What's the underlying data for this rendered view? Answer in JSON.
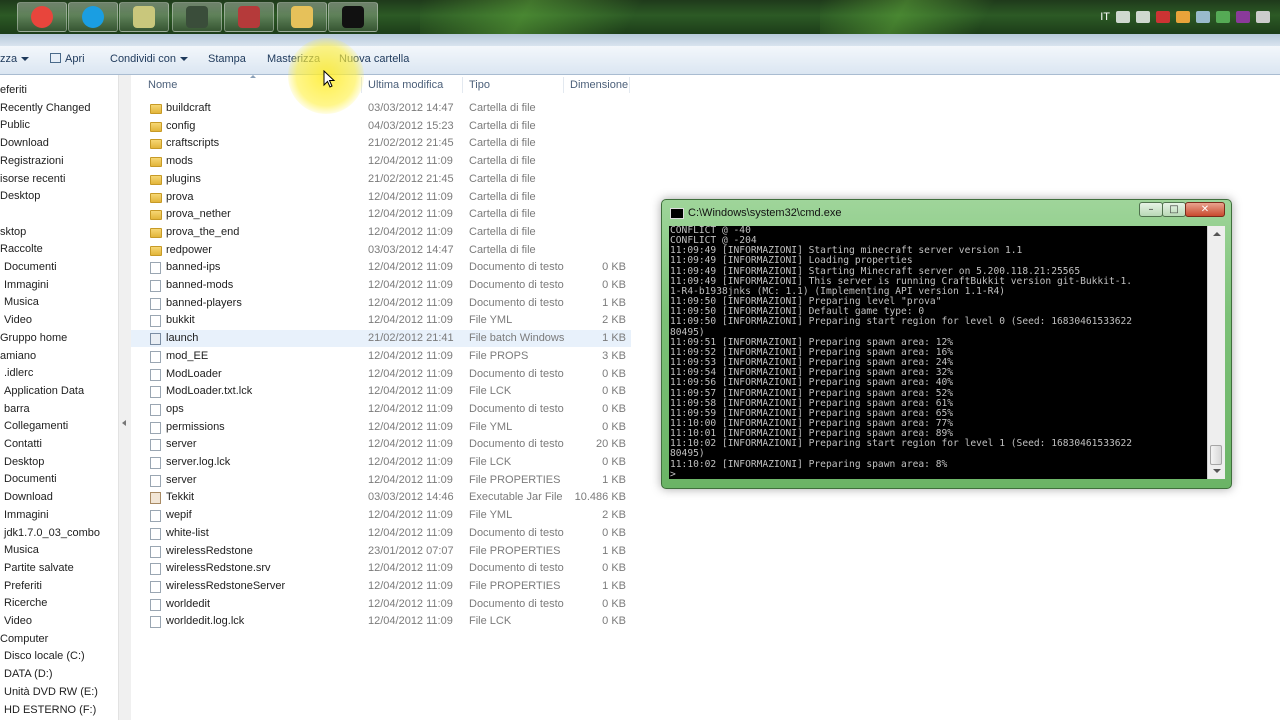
{
  "taskbar": {
    "apps": [
      {
        "name": "chrome",
        "color": "#e8453c"
      },
      {
        "name": "skype",
        "color": "#1a9ee2"
      },
      {
        "name": "notepad",
        "color": "#c9c77c"
      },
      {
        "name": "app4",
        "color": "#3a4d3a"
      },
      {
        "name": "app5",
        "color": "#b53a3a"
      },
      {
        "name": "explorer",
        "color": "#e6c15a"
      },
      {
        "name": "cmd",
        "color": "#111111"
      }
    ],
    "language": "IT"
  },
  "toolbar": {
    "organize": "zza",
    "open": "Apri",
    "share": "Condividi con",
    "print": "Stampa",
    "burn": "Masterizza",
    "new_folder": "Nuova cartella"
  },
  "nav": {
    "items": [
      "eferiti",
      "Recently Changed",
      "Public",
      "Download",
      "Registrazioni",
      "isorse recenti",
      "Desktop",
      "",
      "sktop",
      "Raccolte",
      "Documenti",
      "Immagini",
      "Musica",
      "Video",
      "Gruppo home",
      "amiano",
      ".idlerc",
      "Application Data",
      "barra",
      "Collegamenti",
      "Contatti",
      "Desktop",
      "Documenti",
      "Download",
      "Immagini",
      "jdk1.7.0_03_combo",
      "Musica",
      "Partite salvate",
      "Preferiti",
      "Ricerche",
      "Video",
      "Computer",
      "Disco locale (C:)",
      "DATA (D:)",
      "Unità DVD RW (E:)",
      "HD ESTERNO (F:)"
    ]
  },
  "columns": {
    "name": "Nome",
    "modified": "Ultima modifica",
    "type": "Tipo",
    "size": "Dimensione"
  },
  "files": [
    {
      "name": "buildcraft",
      "date": "03/03/2012 14:47",
      "type": "Cartella di file",
      "size": "",
      "icon": "folder"
    },
    {
      "name": "config",
      "date": "04/03/2012 15:23",
      "type": "Cartella di file",
      "size": "",
      "icon": "folder"
    },
    {
      "name": "craftscripts",
      "date": "21/02/2012 21:45",
      "type": "Cartella di file",
      "size": "",
      "icon": "folder"
    },
    {
      "name": "mods",
      "date": "12/04/2012 11:09",
      "type": "Cartella di file",
      "size": "",
      "icon": "folder"
    },
    {
      "name": "plugins",
      "date": "21/02/2012 21:45",
      "type": "Cartella di file",
      "size": "",
      "icon": "folder"
    },
    {
      "name": "prova",
      "date": "12/04/2012 11:09",
      "type": "Cartella di file",
      "size": "",
      "icon": "folder"
    },
    {
      "name": "prova_nether",
      "date": "12/04/2012 11:09",
      "type": "Cartella di file",
      "size": "",
      "icon": "folder"
    },
    {
      "name": "prova_the_end",
      "date": "12/04/2012 11:09",
      "type": "Cartella di file",
      "size": "",
      "icon": "folder"
    },
    {
      "name": "redpower",
      "date": "03/03/2012 14:47",
      "type": "Cartella di file",
      "size": "",
      "icon": "folder"
    },
    {
      "name": "banned-ips",
      "date": "12/04/2012 11:09",
      "type": "Documento di testo",
      "size": "0 KB",
      "icon": "doc"
    },
    {
      "name": "banned-mods",
      "date": "12/04/2012 11:09",
      "type": "Documento di testo",
      "size": "0 KB",
      "icon": "doc"
    },
    {
      "name": "banned-players",
      "date": "12/04/2012 11:09",
      "type": "Documento di testo",
      "size": "1 KB",
      "icon": "doc"
    },
    {
      "name": "bukkit",
      "date": "12/04/2012 11:09",
      "type": "File YML",
      "size": "2 KB",
      "icon": "doc"
    },
    {
      "name": "launch",
      "date": "21/02/2012 21:41",
      "type": "File batch Windows",
      "size": "1 KB",
      "icon": "bat",
      "selected": true
    },
    {
      "name": "mod_EE",
      "date": "12/04/2012 11:09",
      "type": "File PROPS",
      "size": "3 KB",
      "icon": "doc"
    },
    {
      "name": "ModLoader",
      "date": "12/04/2012 11:09",
      "type": "Documento di testo",
      "size": "0 KB",
      "icon": "doc"
    },
    {
      "name": "ModLoader.txt.lck",
      "date": "12/04/2012 11:09",
      "type": "File LCK",
      "size": "0 KB",
      "icon": "doc"
    },
    {
      "name": "ops",
      "date": "12/04/2012 11:09",
      "type": "Documento di testo",
      "size": "0 KB",
      "icon": "doc"
    },
    {
      "name": "permissions",
      "date": "12/04/2012 11:09",
      "type": "File YML",
      "size": "0 KB",
      "icon": "doc"
    },
    {
      "name": "server",
      "date": "12/04/2012 11:09",
      "type": "Documento di testo",
      "size": "20 KB",
      "icon": "doc"
    },
    {
      "name": "server.log.lck",
      "date": "12/04/2012 11:09",
      "type": "File LCK",
      "size": "0 KB",
      "icon": "doc"
    },
    {
      "name": "server",
      "date": "12/04/2012 11:09",
      "type": "File PROPERTIES",
      "size": "1 KB",
      "icon": "doc"
    },
    {
      "name": "Tekkit",
      "date": "03/03/2012 14:46",
      "type": "Executable Jar File",
      "size": "10.486 KB",
      "icon": "jar"
    },
    {
      "name": "wepif",
      "date": "12/04/2012 11:09",
      "type": "File YML",
      "size": "2 KB",
      "icon": "doc"
    },
    {
      "name": "white-list",
      "date": "12/04/2012 11:09",
      "type": "Documento di testo",
      "size": "0 KB",
      "icon": "doc"
    },
    {
      "name": "wirelessRedstone",
      "date": "23/01/2012 07:07",
      "type": "File PROPERTIES",
      "size": "1 KB",
      "icon": "doc"
    },
    {
      "name": "wirelessRedstone.srv",
      "date": "12/04/2012 11:09",
      "type": "Documento di testo",
      "size": "0 KB",
      "icon": "doc"
    },
    {
      "name": "wirelessRedstoneServer",
      "date": "12/04/2012 11:09",
      "type": "File PROPERTIES",
      "size": "1 KB",
      "icon": "doc"
    },
    {
      "name": "worldedit",
      "date": "12/04/2012 11:09",
      "type": "Documento di testo",
      "size": "0 KB",
      "icon": "doc"
    },
    {
      "name": "worldedit.log.lck",
      "date": "12/04/2012 11:09",
      "type": "File LCK",
      "size": "0 KB",
      "icon": "doc"
    }
  ],
  "cmd": {
    "title": "C:\\Windows\\system32\\cmd.exe",
    "lines": [
      "CONFLICT @ -40",
      "CONFLICT @ -204",
      "11:09:49 [INFORMAZIONI] Starting minecraft server version 1.1",
      "11:09:49 [INFORMAZIONI] Loading properties",
      "11:09:49 [INFORMAZIONI] Starting Minecraft server on 5.200.118.21:25565",
      "11:09:49 [INFORMAZIONI] This server is running CraftBukkit version git-Bukkit-1.",
      "1-R4-b1938jnks (MC: 1.1) (Implementing API version 1.1-R4)",
      "11:09:50 [INFORMAZIONI] Preparing level \"prova\"",
      "11:09:50 [INFORMAZIONI] Default game type: 0",
      "11:09:50 [INFORMAZIONI] Preparing start region for level 0 (Seed: 16830461533622",
      "80495)",
      "11:09:51 [INFORMAZIONI] Preparing spawn area: 12%",
      "11:09:52 [INFORMAZIONI] Preparing spawn area: 16%",
      "11:09:53 [INFORMAZIONI] Preparing spawn area: 24%",
      "11:09:54 [INFORMAZIONI] Preparing spawn area: 32%",
      "11:09:56 [INFORMAZIONI] Preparing spawn area: 40%",
      "11:09:57 [INFORMAZIONI] Preparing spawn area: 52%",
      "11:09:58 [INFORMAZIONI] Preparing spawn area: 61%",
      "11:09:59 [INFORMAZIONI] Preparing spawn area: 65%",
      "11:10:00 [INFORMAZIONI] Preparing spawn area: 77%",
      "11:10:01 [INFORMAZIONI] Preparing spawn area: 89%",
      "11:10:02 [INFORMAZIONI] Preparing start region for level 1 (Seed: 16830461533622",
      "80495)",
      "11:10:02 [INFORMAZIONI] Preparing spawn area: 8%",
      ">"
    ]
  }
}
